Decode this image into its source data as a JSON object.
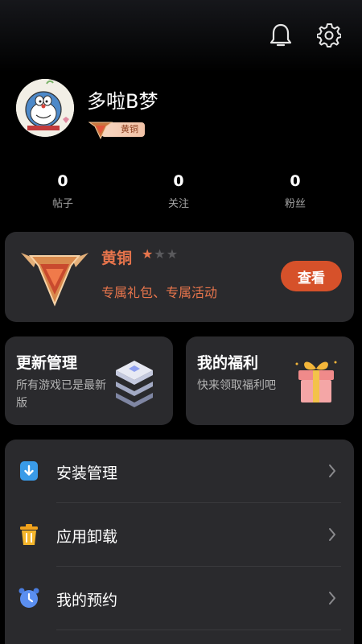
{
  "profile": {
    "username": "多啦B梦",
    "rank_label": "黄铜"
  },
  "stats": [
    {
      "value": "0",
      "label": "帖子"
    },
    {
      "value": "0",
      "label": "关注"
    },
    {
      "value": "0",
      "label": "粉丝"
    }
  ],
  "vip": {
    "title": "黄铜",
    "stars_filled": 1,
    "stars_total": 3,
    "subtitle": "专属礼包、专属活动",
    "button_label": "查看"
  },
  "cards": {
    "update": {
      "title": "更新管理",
      "desc": "所有游戏已是最新版"
    },
    "welfare": {
      "title": "我的福利",
      "desc": "快来领取福利吧"
    }
  },
  "menu": [
    {
      "label": "安装管理",
      "icon": "install-icon",
      "color": "#3a9be8"
    },
    {
      "label": "应用卸载",
      "icon": "trash-icon",
      "color": "#f0a21c"
    },
    {
      "label": "我的预约",
      "icon": "alarm-clock-icon",
      "color": "#4a7de0"
    }
  ],
  "colors": {
    "accent": "#e8754c",
    "button": "#d6512a",
    "card_bg": "#2a2a2d",
    "background": "#000000"
  }
}
